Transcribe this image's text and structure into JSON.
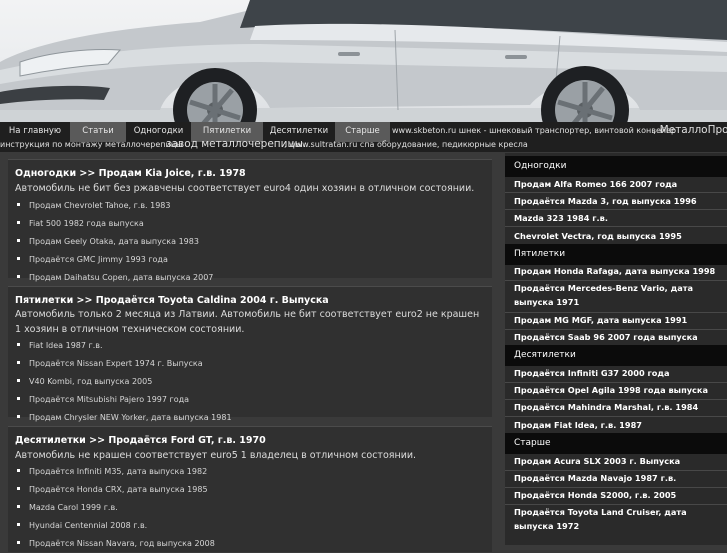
{
  "nav": {
    "tabs": [
      "На главную",
      "Статьи",
      "Одногодки",
      "Пятилетки",
      "Десятилетки",
      "Старше"
    ],
    "ticker_line1_a": "www.skbeton.ru шнек - шнековый транспортер, винтовой конвейер",
    "ticker_line1_b": ", МеталлоПроф",
    "ticker_line2_a": "инструкция по монтажу металлочерепицы",
    "ticker_line2_b": "завод металлочерепицы.",
    "ticker_line2_c": ", www.sultratan.ru спа оборудование, педикюрные кресла"
  },
  "posts": [
    {
      "title": "Одногодки >> Продам Kia Joice, г.в. 1978",
      "text": "Автомобиль не бит без ржавчены соответствует euro4 один хозяин в отличном состоянии.",
      "links": [
        "Продам Chevrolet Tahoe, г.в. 1983",
        "Fiat 500 1982 года выпуска",
        "Продам Geely Otaka, дата выпуска 1983",
        "Продаётся GMC Jimmy 1993 года",
        "Продам Daihatsu Copen, дата выпуска 2007"
      ]
    },
    {
      "title": "Пятилетки >> Продаётся Toyota Caldina 2004 г. Выпуска",
      "text": "Автомобиль только 2 месяца из Латвии. Автомобиль не бит соответствует euro2 не крашен 1 хозяин в отличном техническом состоянии.",
      "links": [
        "Fiat Idea 1987 г.в.",
        "Продаётся Nissan Expert 1974 г. Выпуска",
        "V40 Kombi, год выпуска 2005",
        "Продаётся Mitsubishi Pajero 1997 года",
        "Продам Chrysler NEW Yorker, дата выпуска 1981"
      ]
    },
    {
      "title": "Десятилетки >> Продаётся Ford GT, г.в. 1970",
      "text": "Автомобиль не крашен соответствует euro5 1 владелец в отличном состоянии.",
      "links": [
        "Продаётся Infiniti M35, дата выпуска 1982",
        "Продаётся Honda CRX, дата выпуска 1985",
        "Mazda Carol 1999 г.в.",
        "Hyundai Centennial 2008 г.в.",
        "Продаётся Nissan Navara, год выпуска 2008"
      ]
    }
  ],
  "sidebar": [
    {
      "heading": "Одногодки",
      "items": [
        "Продам Alfa Romeo 166 2007 года",
        "Продаётся Mazda 3, год выпуска 1996",
        "Mazda 323 1984 г.в.",
        "Chevrolet Vectra, год выпуска 1995"
      ]
    },
    {
      "heading": "Пятилетки",
      "items": [
        "Продам Honda Rafaga, дата выпуска 1998",
        "Продаётся Mercedes-Benz Vario, дата выпуска 1971",
        "Продам MG MGF, дата выпуска 1991",
        "Продаётся Saab 96 2007 года выпуска"
      ]
    },
    {
      "heading": "Десятилетки",
      "items": [
        "Продаётся Infiniti G37 2000 года",
        "Продаётся Opel Agila 1998 года выпуска",
        "Продаётся Mahindra Marshal, г.в. 1984",
        "Продам Fiat Idea, г.в. 1987"
      ]
    },
    {
      "heading": "Старше",
      "items": [
        "Продам Acura SLX 2003 г. Выпуска",
        "Продаётся Mazda Navajo 1987 г.в.",
        "Продаётся Honda S2000, г.в. 2005",
        "Продаётся Toyota Land Cruiser, дата выпуска 1972"
      ]
    }
  ]
}
